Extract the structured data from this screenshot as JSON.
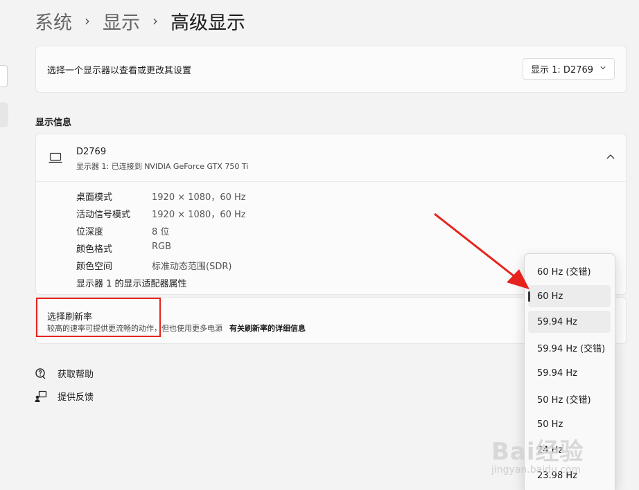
{
  "breadcrumb": {
    "items": [
      "系统",
      "显示"
    ],
    "separator": "›",
    "current": "高级显示"
  },
  "display_select": {
    "label": "选择一个显示器以查看或更改其设置",
    "value": "显示 1: D2769"
  },
  "display_info": {
    "section_title": "显示信息",
    "monitor_name": "D2769",
    "monitor_sub": "显示器 1: 已连接到 NVIDIA GeForce GTX 750 Ti",
    "rows": [
      {
        "label": "桌面模式",
        "value": "1920 × 1080，60 Hz"
      },
      {
        "label": "活动信号模式",
        "value": "1920 × 1080，60 Hz"
      },
      {
        "label": "位深度",
        "value": "8 位"
      },
      {
        "label": "颜色格式",
        "value": "RGB"
      },
      {
        "label": "颜色空间",
        "value": "标准动态范围(SDR)"
      }
    ],
    "adapter_link": "显示器 1 的显示适配器属性"
  },
  "refresh_rate": {
    "title": "选择刷新率",
    "description": "较高的速率可提供更流畅的动作，但也使用更多电源",
    "link": "有关刷新率的详细信息",
    "options": [
      "60 Hz (交错)",
      "60 Hz",
      "59.94 Hz",
      "59.94 Hz (交错)",
      "59.94 Hz",
      "50 Hz (交错)",
      "50 Hz",
      "24 Hz",
      "23.98 Hz"
    ],
    "selected": "60 Hz"
  },
  "help": {
    "get_help": "获取帮助",
    "feedback": "提供反馈"
  },
  "watermark": {
    "logo": "Bai经验",
    "url": "jingyan.baidu.com"
  },
  "colors": {
    "annotation_red": "#e5231c",
    "background": "#f3f3f3",
    "card": "#fbfbfb"
  }
}
